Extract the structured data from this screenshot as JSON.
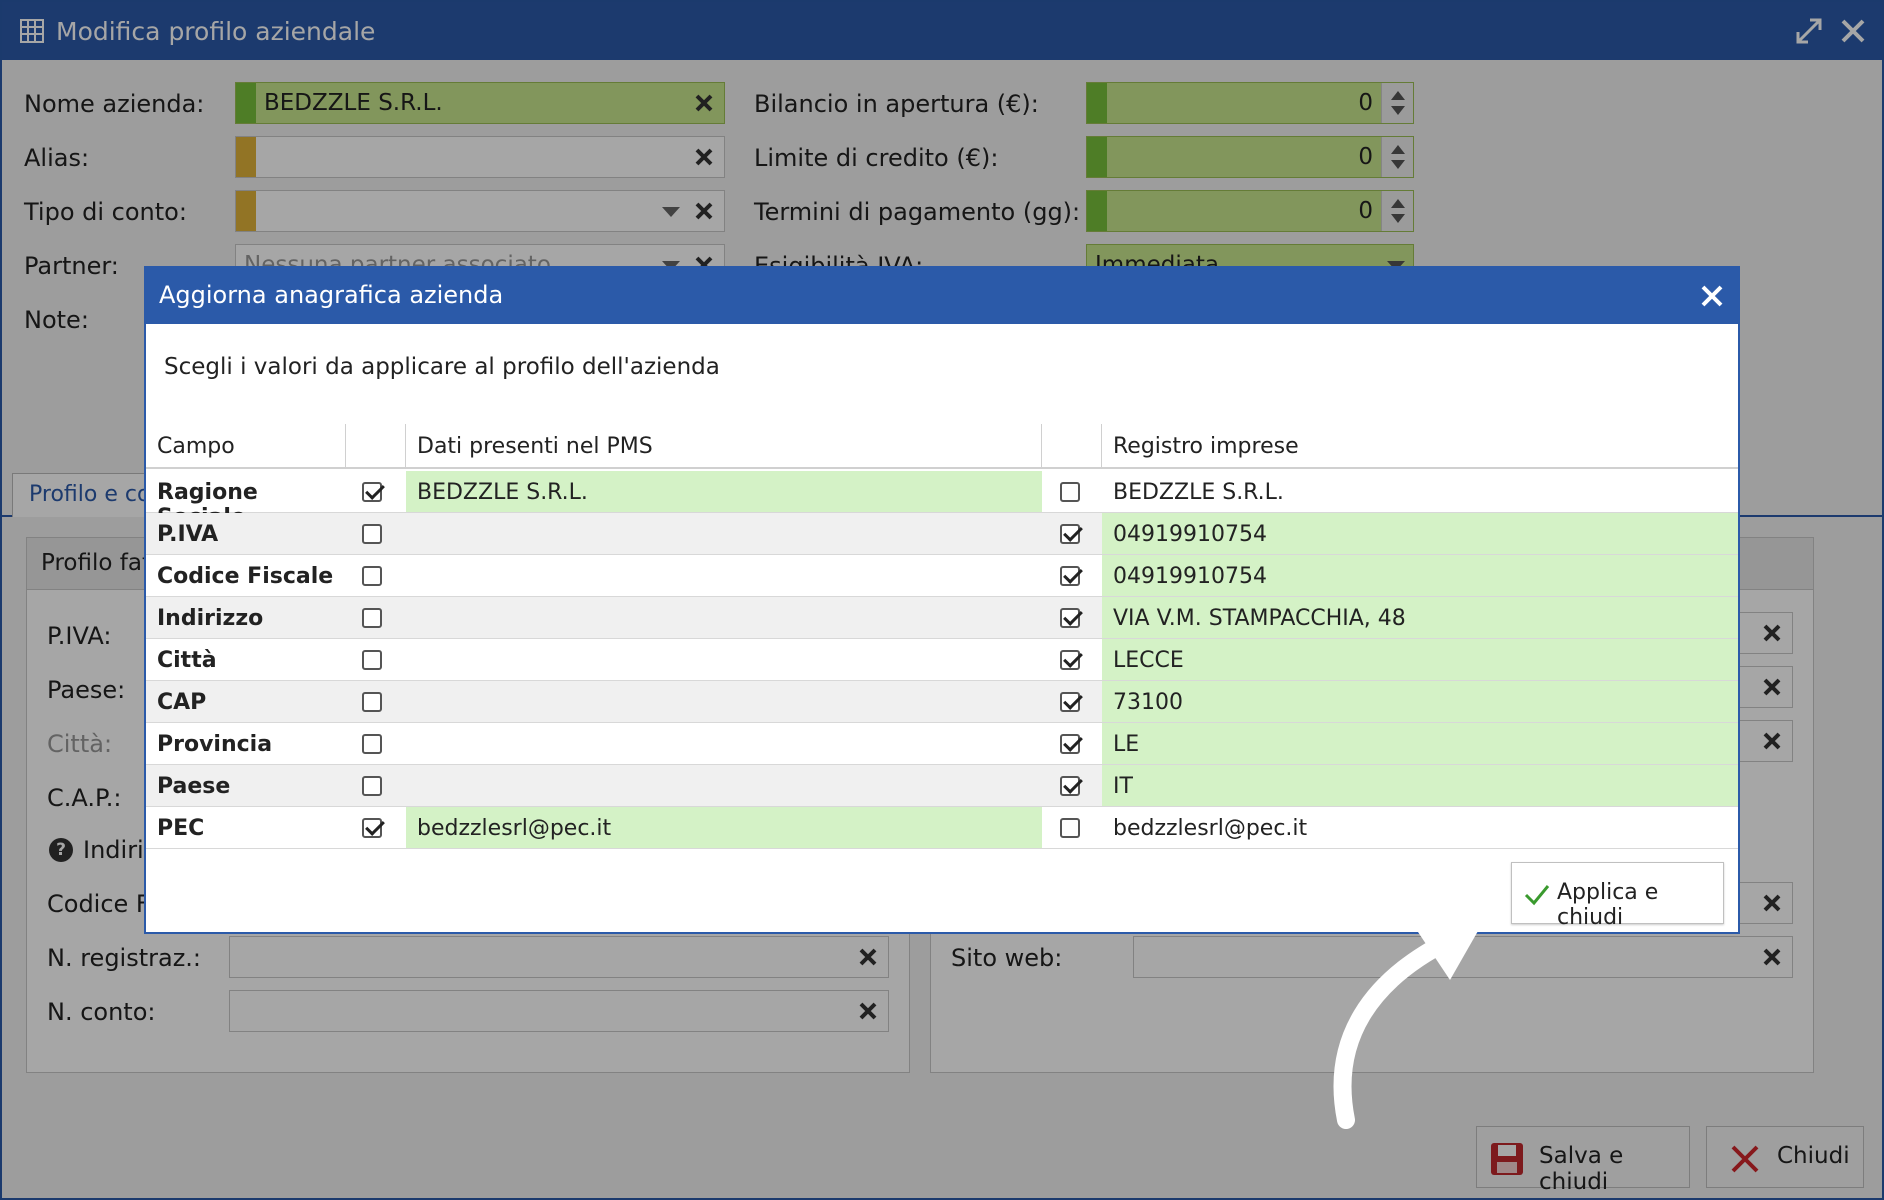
{
  "window": {
    "title": "Modifica profilo aziendale"
  },
  "form": {
    "nome_label": "Nome azienda:",
    "nome_value": "BEDZZLE S.R.L.",
    "alias_label": "Alias:",
    "tipo_label": "Tipo di conto:",
    "partner_label": "Partner:",
    "partner_placeholder": "Nessuna partner associato",
    "note_label": "Note:",
    "bilancio_label": "Bilancio in apertura (€):",
    "bilancio_value": "0",
    "limite_label": "Limite di credito (€):",
    "limite_value": "0",
    "termini_label": "Termini di pagamento (gg):",
    "termini_value": "0",
    "esig_label": "Esigibilità IVA:",
    "esig_value": "Immediata"
  },
  "tabs": {
    "profile_tab": "Profilo e cor"
  },
  "billing": {
    "head": "Profilo fat",
    "piva_label": "P.IVA:",
    "paese_label": "Paese:",
    "citta_label": "Città:",
    "cap_label": "C.A.P.:",
    "indiriz_label": "Indiriz",
    "codfisc_label": "Codice Fi",
    "nregistr_label": "N. registraz.:",
    "nconto_label": "N. conto:"
  },
  "right_panel": {
    "sito_label": "Sito web:"
  },
  "footer": {
    "save_label": "Salva e chiudi",
    "close_label": "Chiudi"
  },
  "dialog": {
    "title": "Aggiorna anagrafica azienda",
    "subtitle": "Scegli i valori da applicare al profilo dell'azienda",
    "headers": {
      "campo": "Campo",
      "pms": "Dati presenti nel PMS",
      "registro": "Registro imprese"
    },
    "rows": [
      {
        "campo": "Ragione Sociale",
        "pms": "BEDZZLE S.R.L.",
        "reg": "BEDZZLE S.R.L.",
        "pms_checked": true,
        "reg_checked": false
      },
      {
        "campo": "P.IVA",
        "pms": "",
        "reg": "04919910754",
        "pms_checked": false,
        "reg_checked": true
      },
      {
        "campo": "Codice Fiscale",
        "pms": "",
        "reg": "04919910754",
        "pms_checked": false,
        "reg_checked": true
      },
      {
        "campo": "Indirizzo",
        "pms": "",
        "reg": "VIA V.M. STAMPACCHIA, 48",
        "pms_checked": false,
        "reg_checked": true
      },
      {
        "campo": "Città",
        "pms": "",
        "reg": "LECCE",
        "pms_checked": false,
        "reg_checked": true
      },
      {
        "campo": "CAP",
        "pms": "",
        "reg": "73100",
        "pms_checked": false,
        "reg_checked": true
      },
      {
        "campo": "Provincia",
        "pms": "",
        "reg": "LE",
        "pms_checked": false,
        "reg_checked": true
      },
      {
        "campo": "Paese",
        "pms": "",
        "reg": "IT",
        "pms_checked": false,
        "reg_checked": true
      },
      {
        "campo": "PEC",
        "pms": "bedzzlesrl@pec.it",
        "reg": "bedzzlesrl@pec.it",
        "pms_checked": true,
        "reg_checked": false
      }
    ],
    "apply_label": "Applica e chiudi"
  },
  "colors": {
    "accent": "#2b5aa9",
    "selected_cell": "#d4f2c6",
    "field_green": "#c8e68e"
  }
}
